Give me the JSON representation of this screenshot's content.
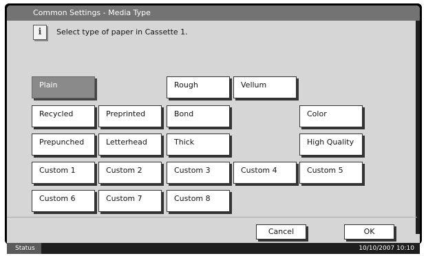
{
  "window": {
    "title": "Common Settings - Media Type"
  },
  "message": {
    "text": "Select type of paper in Cassette 1.",
    "icon": "info-icon"
  },
  "media_types": [
    {
      "label": "Plain",
      "selected": true
    },
    {
      "label": "Rough",
      "selected": false
    },
    {
      "label": "Vellum",
      "selected": false
    },
    {
      "label": "Recycled",
      "selected": false
    },
    {
      "label": "Preprinted",
      "selected": false
    },
    {
      "label": "Bond",
      "selected": false
    },
    {
      "label": "Color",
      "selected": false
    },
    {
      "label": "Prepunched",
      "selected": false
    },
    {
      "label": "Letterhead",
      "selected": false
    },
    {
      "label": "Thick",
      "selected": false
    },
    {
      "label": "High Quality",
      "selected": false
    },
    {
      "label": "Custom 1",
      "selected": false
    },
    {
      "label": "Custom 2",
      "selected": false
    },
    {
      "label": "Custom 3",
      "selected": false
    },
    {
      "label": "Custom 4",
      "selected": false
    },
    {
      "label": "Custom 5",
      "selected": false
    },
    {
      "label": "Custom 6",
      "selected": false
    },
    {
      "label": "Custom 7",
      "selected": false
    },
    {
      "label": "Custom 8",
      "selected": false
    }
  ],
  "footer": {
    "cancel_label": "Cancel",
    "ok_label": "OK"
  },
  "statusbar": {
    "status_label": "Status",
    "datetime": "10/10/2007   10:10"
  }
}
